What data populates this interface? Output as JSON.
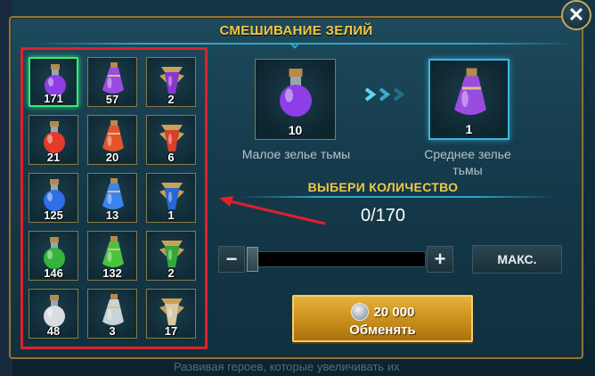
{
  "window": {
    "title": "СМЕШИВАНИЕ ЗЕЛИЙ",
    "close_label": "✕",
    "background_text": "Развивая героев, которые увеличивать их"
  },
  "inventory": {
    "items": [
      {
        "count": "171",
        "color": "#8d3fe6",
        "icon": "small-dark-potion-icon",
        "selected": true
      },
      {
        "count": "57",
        "color": "#9b4ce0",
        "icon": "medium-dark-potion-icon"
      },
      {
        "count": "2",
        "color": "#8a37d0",
        "icon": "large-dark-potion-icon"
      },
      {
        "count": "21",
        "color": "#e33b2b",
        "icon": "small-red-potion-icon"
      },
      {
        "count": "20",
        "color": "#e4532a",
        "icon": "medium-red-potion-icon"
      },
      {
        "count": "6",
        "color": "#d9402a",
        "icon": "large-red-potion-icon"
      },
      {
        "count": "125",
        "color": "#2f6fe8",
        "icon": "small-blue-potion-icon"
      },
      {
        "count": "13",
        "color": "#3a84ee",
        "icon": "medium-blue-potion-icon"
      },
      {
        "count": "1",
        "color": "#2a66d6",
        "icon": "large-blue-potion-icon"
      },
      {
        "count": "146",
        "color": "#35b33a",
        "icon": "small-green-potion-icon"
      },
      {
        "count": "132",
        "color": "#48c43c",
        "icon": "medium-green-potion-icon"
      },
      {
        "count": "2",
        "color": "#35a83a",
        "icon": "large-green-potion-icon"
      },
      {
        "count": "48",
        "color": "#d9dde0",
        "icon": "small-white-potion-icon"
      },
      {
        "count": "3",
        "color": "#c9d2d6",
        "icon": "medium-white-potion-icon"
      },
      {
        "count": "17",
        "color": "#d6c9a6",
        "icon": "large-white-potion-icon"
      }
    ]
  },
  "recipe": {
    "source": {
      "count": "10",
      "label": "Малое зелье тьмы",
      "color": "#8d3fe6"
    },
    "target": {
      "count": "1",
      "label": "Среднее зелье тьмы",
      "color": "#9b4ce0"
    }
  },
  "quantity": {
    "label": "ВЫБЕРИ КОЛИЧЕСТВО",
    "value": "0/170",
    "fraction": 0,
    "minus": "−",
    "plus": "+",
    "max_label": "МАКС."
  },
  "exchange": {
    "price": "20 000",
    "label": "Обменять"
  },
  "colors": {
    "accent_gold": "#f1c845",
    "selected_green": "#39e878",
    "highlight_red": "#e0202b",
    "button_gold": "#d69d27"
  }
}
